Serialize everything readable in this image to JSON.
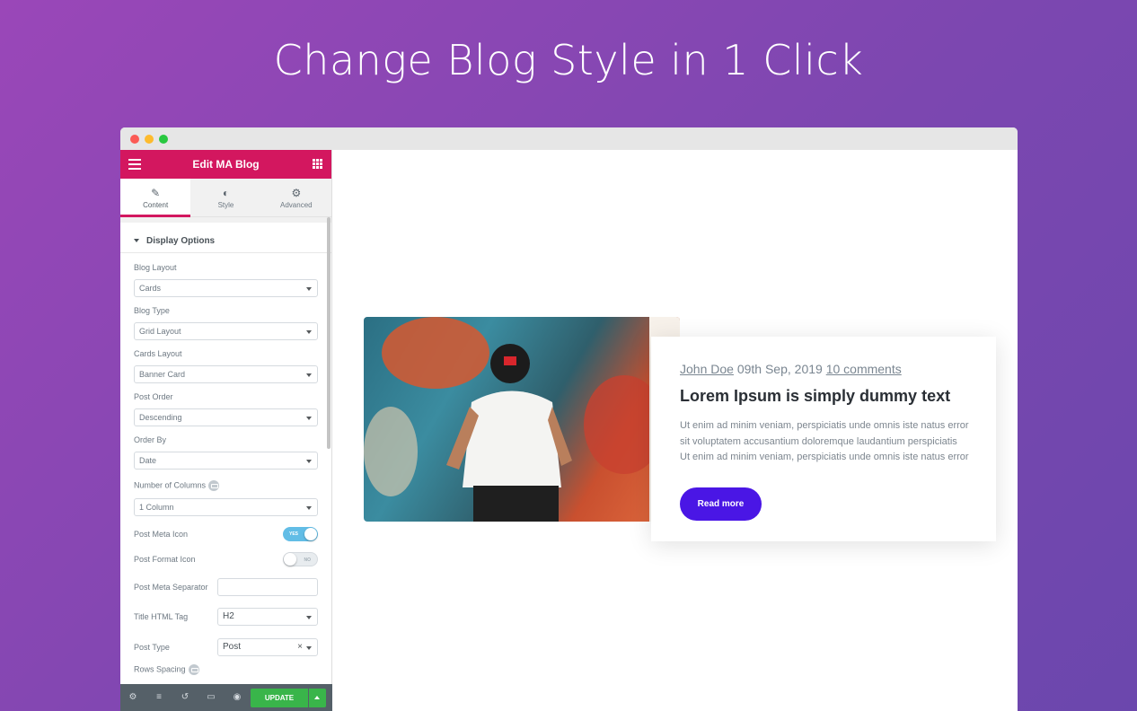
{
  "headline": "Change Blog Style in 1 Click",
  "panel": {
    "title": "Edit MA Blog",
    "tabs": [
      {
        "label": "Content",
        "icon": "pencil-icon"
      },
      {
        "label": "Style",
        "icon": "contrast-icon"
      },
      {
        "label": "Advanced",
        "icon": "gear-icon"
      }
    ],
    "section": "Display Options",
    "controls": {
      "blog_layout": {
        "label": "Blog Layout",
        "value": "Cards"
      },
      "blog_type": {
        "label": "Blog Type",
        "value": "Grid Layout"
      },
      "cards_layout": {
        "label": "Cards Layout",
        "value": "Banner Card"
      },
      "post_order": {
        "label": "Post Order",
        "value": "Descending"
      },
      "order_by": {
        "label": "Order By",
        "value": "Date"
      },
      "num_columns": {
        "label": "Number of Columns",
        "value": "1 Column"
      },
      "post_meta_icon": {
        "label": "Post Meta Icon",
        "state": "YES"
      },
      "post_format_icon": {
        "label": "Post Format Icon",
        "state": "NO"
      },
      "post_meta_separator": {
        "label": "Post Meta Separator",
        "value": ""
      },
      "title_html_tag": {
        "label": "Title HTML Tag",
        "value": "H2"
      },
      "post_type": {
        "label": "Post Type",
        "value": "Post"
      },
      "rows_spacing": {
        "label": "Rows Spacing"
      }
    },
    "update_label": "UPDATE"
  },
  "post": {
    "author": "John Doe",
    "date": "09th Sep, 2019",
    "comments": "10 comments",
    "title": "Lorem Ipsum is simply dummy text",
    "excerpt_lines": [
      "Ut enim ad minim veniam, perspiciatis unde omnis iste natus error",
      "sit voluptatem accusantium doloremque laudantium  perspiciatis",
      "Ut enim ad minim veniam, perspiciatis unde omnis iste natus error"
    ],
    "read_more": "Read more"
  },
  "colors": {
    "brand_pink": "#d3175f",
    "update_green": "#39b54a",
    "read_more_purple": "#4a16e5",
    "toggle_on": "#62bde6"
  }
}
